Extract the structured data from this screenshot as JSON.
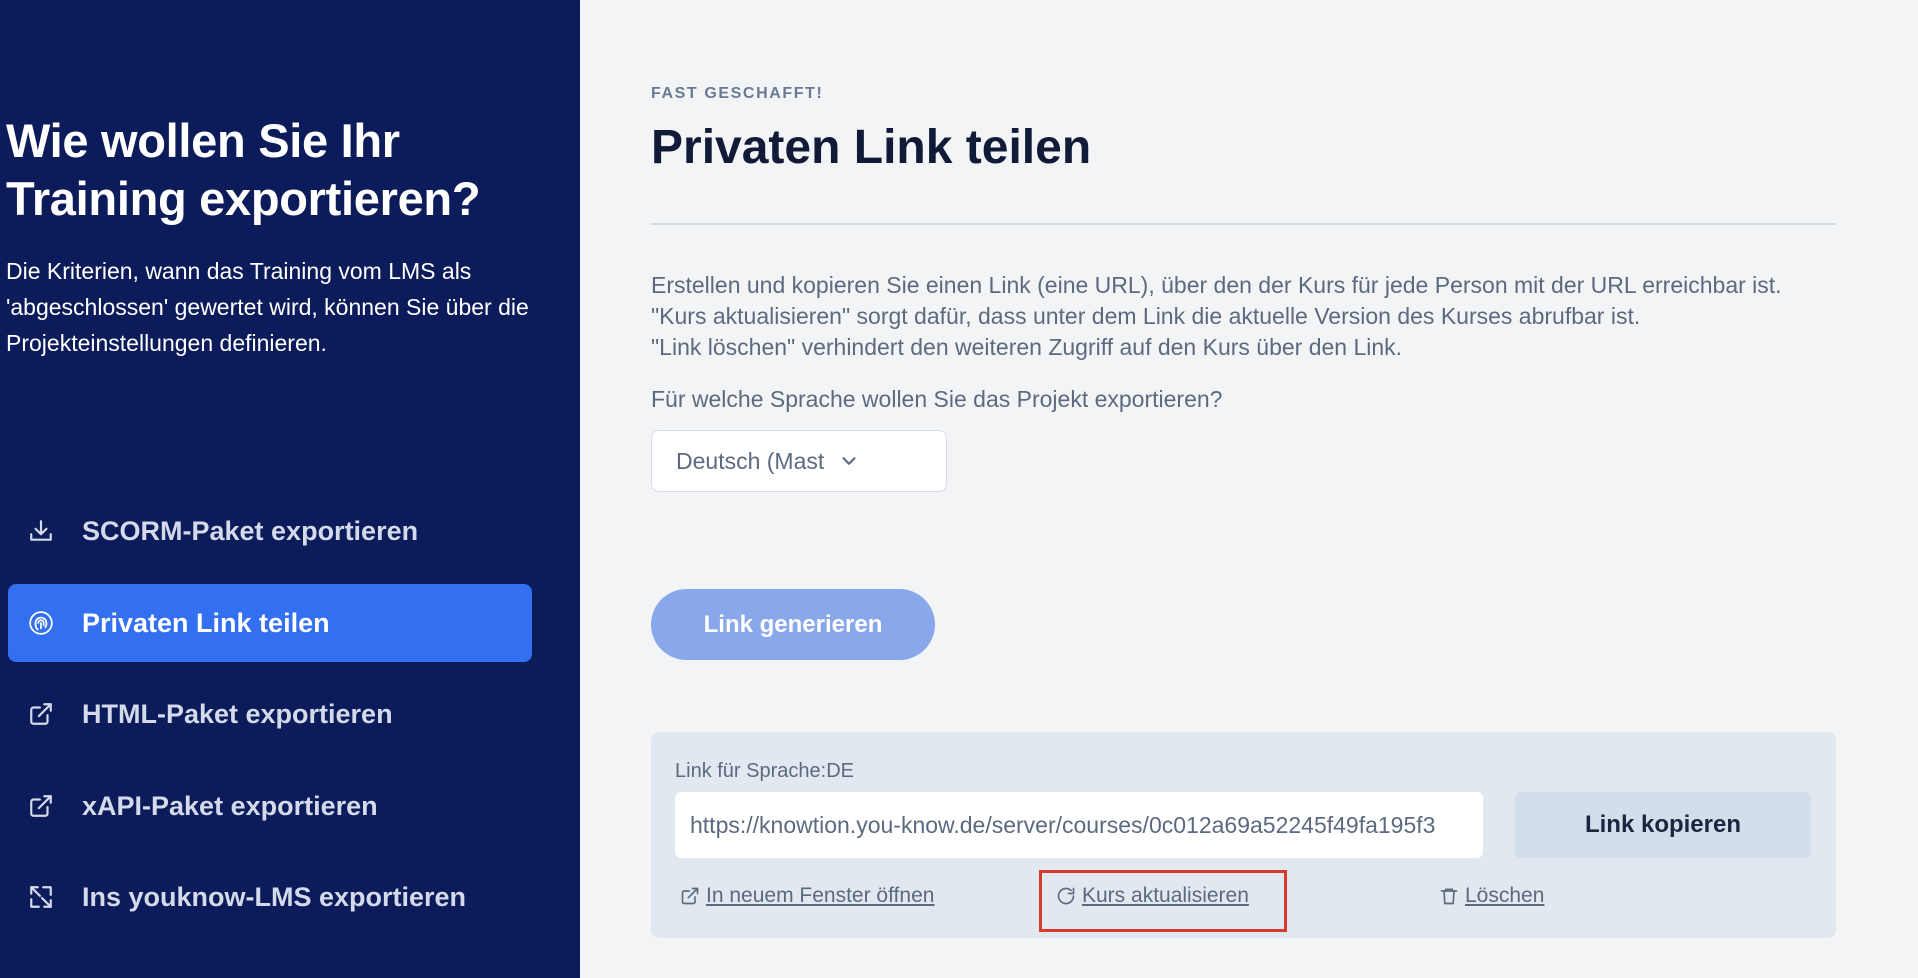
{
  "sidebar": {
    "title": "Wie wollen Sie Ihr Training exportieren?",
    "description": "Die Kriterien, wann das Training vom LMS als 'abgeschlossen' gewertet wird, können Sie über die Projekteinstellungen definieren.",
    "items": [
      {
        "label": "SCORM-Paket exportieren",
        "icon": "download-icon",
        "active": false
      },
      {
        "label": "Privaten Link teilen",
        "icon": "fingerprint-icon",
        "active": true
      },
      {
        "label": "HTML-Paket exportieren",
        "icon": "external-link-icon",
        "active": false
      },
      {
        "label": "xAPI-Paket exportieren",
        "icon": "external-link-icon",
        "active": false
      },
      {
        "label": "Ins youknow-LMS exportieren",
        "icon": "transfer-icon",
        "active": false
      }
    ]
  },
  "main": {
    "eyebrow": "FAST GESCHAFFT!",
    "title": "Privaten Link teilen",
    "info_lines": [
      "Erstellen und kopieren Sie einen Link (eine URL), über den der Kurs für jede Person mit der URL erreichbar ist.",
      "\"Kurs aktualisieren\" sorgt dafür, dass unter dem Link die aktuelle Version des Kurses abrufbar ist.",
      "\"Link löschen\" verhindert den weiteren Zugriff auf den Kurs über den Link."
    ],
    "language_question": "Für welche Sprache wollen Sie das Projekt exportieren?",
    "language_selected": "Deutsch (Mast",
    "generate_button": "Link generieren",
    "link_panel": {
      "label": "Link für Sprache:DE",
      "url": "https://knowtion.you-know.de/server/courses/0c012a69a52245f49fa195f3",
      "copy_button": "Link kopieren",
      "open_new_window": "In neuem Fenster öffnen",
      "update_course": "Kurs aktualisieren",
      "delete": "Löschen"
    }
  },
  "colors": {
    "sidebar_bg": "#0c1b5a",
    "active_item": "#336ff1",
    "generate_button": "#89a8ec",
    "highlight": "#d93a2b"
  }
}
